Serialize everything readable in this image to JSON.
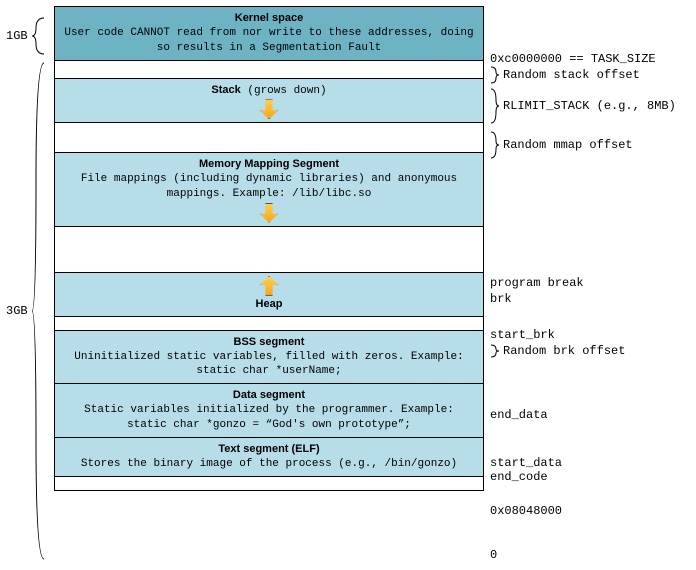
{
  "left": {
    "kernel_size": "1GB",
    "user_size": "3GB"
  },
  "segments": {
    "kernel": {
      "title": "Kernel space",
      "desc": "User code CANNOT read from nor write to these addresses, doing so results in a Segmentation Fault"
    },
    "stack": {
      "title": "Stack",
      "suffix": " (grows down)"
    },
    "mmap": {
      "title": "Memory Mapping Segment",
      "desc": "File mappings (including dynamic libraries) and anonymous mappings. Example: /lib/libc.so"
    },
    "heap": {
      "title": "Heap"
    },
    "bss": {
      "title": "BSS segment",
      "desc": "Uninitialized static variables, filled with zeros. Example: static char *userName;"
    },
    "data": {
      "title": "Data segment",
      "desc": "Static variables initialized by the programmer. Example: static char *gonzo = “God's own prototype”;"
    },
    "text": {
      "title": "Text segment (ELF)",
      "desc": "Stores the binary image of the process (e.g., /bin/gonzo)"
    }
  },
  "right": {
    "task_size": "0xc0000000 == TASK_SIZE",
    "rand_stack": "Random stack offset",
    "rlimit": "RLIMIT_STACK (e.g., 8MB)",
    "rand_mmap": "Random mmap offset",
    "prog_break": "program break",
    "brk": "brk",
    "start_brk": "start_brk",
    "rand_brk": "Random brk offset",
    "end_data": "end_data",
    "start_data": "start_data",
    "end_code": "end_code",
    "text_base": "0x08048000",
    "zero": "0"
  }
}
